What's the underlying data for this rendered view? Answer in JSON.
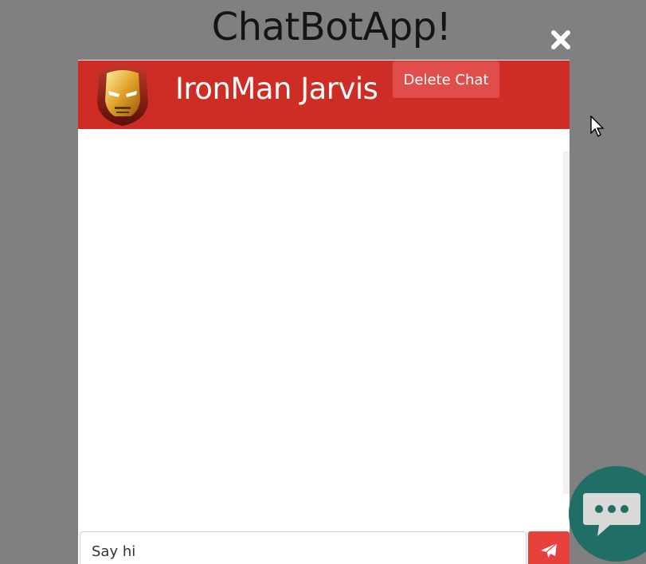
{
  "page": {
    "title": "ChatBotApp!",
    "close_icon": "close-icon"
  },
  "chat": {
    "header": {
      "bot_name": "IronMan Jarvis",
      "avatar_icon": "ironman-helmet-icon",
      "delete_label": "Delete Chat"
    },
    "input": {
      "value": "Say hi",
      "placeholder": ""
    },
    "send_icon": "paper-plane-icon"
  },
  "launcher": {
    "icon": "chat-bubble-icon"
  },
  "colors": {
    "header": "#cd2d25",
    "delete_button": "#e14d4a",
    "send_button": "#e8413c",
    "launcher": "#1f6f66",
    "overlay": "#808080"
  }
}
